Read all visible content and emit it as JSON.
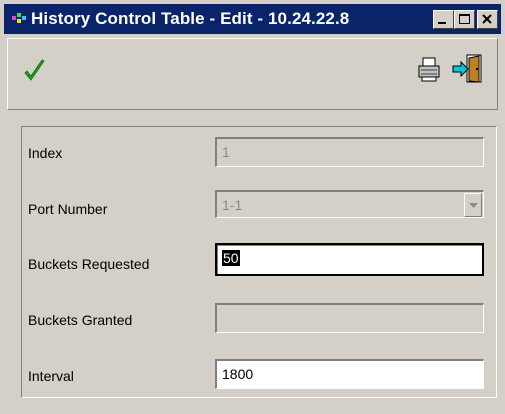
{
  "window": {
    "title": "History Control Table - Edit - 10.24.22.8"
  },
  "toolbar": {
    "apply_icon": "checkmark-icon",
    "print_icon": "printer-icon",
    "exit_icon": "exit-door-icon"
  },
  "form": {
    "index": {
      "label": "Index",
      "value": "1"
    },
    "port_number": {
      "label": "Port Number",
      "value": "1-1"
    },
    "buckets_requested": {
      "label": "Buckets Requested",
      "value": "50"
    },
    "buckets_granted": {
      "label": "Buckets Granted",
      "value": ""
    },
    "interval": {
      "label": "Interval",
      "value": "1800"
    }
  },
  "colors": {
    "titlebar": "#0a246a",
    "face": "#d4d0c8",
    "check": "#1aa01a"
  }
}
